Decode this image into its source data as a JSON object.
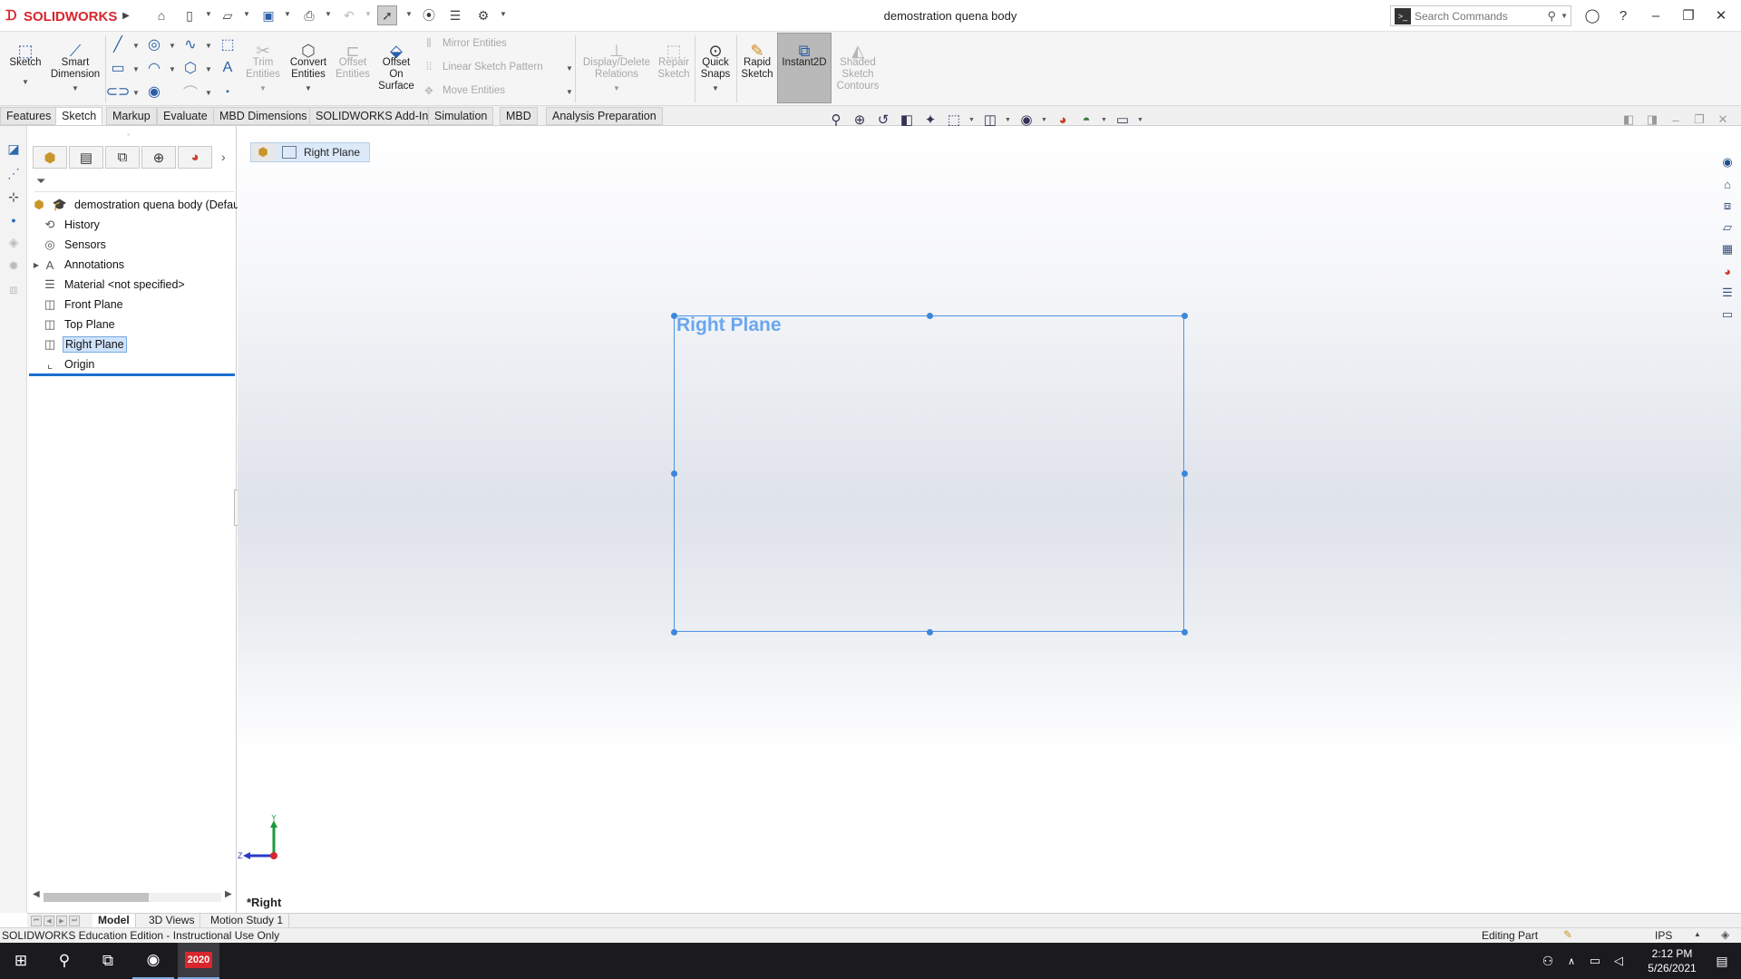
{
  "app": {
    "brand": "SOLIDWORKS",
    "document_title": "demostration quena body"
  },
  "search": {
    "placeholder": "Search Commands"
  },
  "ribbon": {
    "sketch": "Sketch",
    "smart_dimension": [
      "Smart",
      "Dimension"
    ],
    "trim_entities": [
      "Trim",
      "Entities"
    ],
    "convert_entities": [
      "Convert",
      "Entities"
    ],
    "offset_entities": [
      "Offset",
      "Entities"
    ],
    "offset_on_surface": [
      "Offset",
      "On",
      "Surface"
    ],
    "mirror_entities": "Mirror Entities",
    "linear_sketch_pattern": "Linear Sketch Pattern",
    "move_entities": "Move Entities",
    "display_delete_relations": [
      "Display/Delete",
      "Relations"
    ],
    "repair_sketch": [
      "Repair",
      "Sketch"
    ],
    "quick_snaps": [
      "Quick",
      "Snaps"
    ],
    "rapid_sketch": [
      "Rapid",
      "Sketch"
    ],
    "instant2d": "Instant2D",
    "shaded_sketch_contours": [
      "Shaded",
      "Sketch",
      "Contours"
    ]
  },
  "tabs": [
    {
      "label": "Features"
    },
    {
      "label": "Sketch"
    },
    {
      "label": "Markup"
    },
    {
      "label": "Evaluate"
    },
    {
      "label": "MBD Dimensions"
    },
    {
      "label": "SOLIDWORKS Add-Ins"
    },
    {
      "label": "Simulation"
    },
    {
      "label": "MBD"
    },
    {
      "label": "Analysis Preparation"
    }
  ],
  "tree": {
    "root": "demostration quena body  (Defau",
    "items": [
      {
        "label": "History"
      },
      {
        "label": "Sensors"
      },
      {
        "label": "Annotations"
      },
      {
        "label": "Material <not specified>"
      },
      {
        "label": "Front Plane"
      },
      {
        "label": "Top Plane"
      },
      {
        "label": "Right Plane"
      },
      {
        "label": "Origin"
      }
    ]
  },
  "graphics": {
    "breadcrumb": "Right Plane",
    "plane_label": "Right Plane",
    "view_name": "*Right",
    "triad": {
      "y": "Y",
      "z": "Z"
    }
  },
  "model_tabs": [
    {
      "label": "Model"
    },
    {
      "label": "3D Views"
    },
    {
      "label": "Motion Study 1"
    }
  ],
  "status": {
    "left": "SOLIDWORKS Education Edition - Instructional Use Only",
    "mode": "Editing Part",
    "units": "IPS"
  },
  "taskbar": {
    "time": "2:12 PM",
    "date": "5/26/2021",
    "sw_badge": "2020"
  }
}
